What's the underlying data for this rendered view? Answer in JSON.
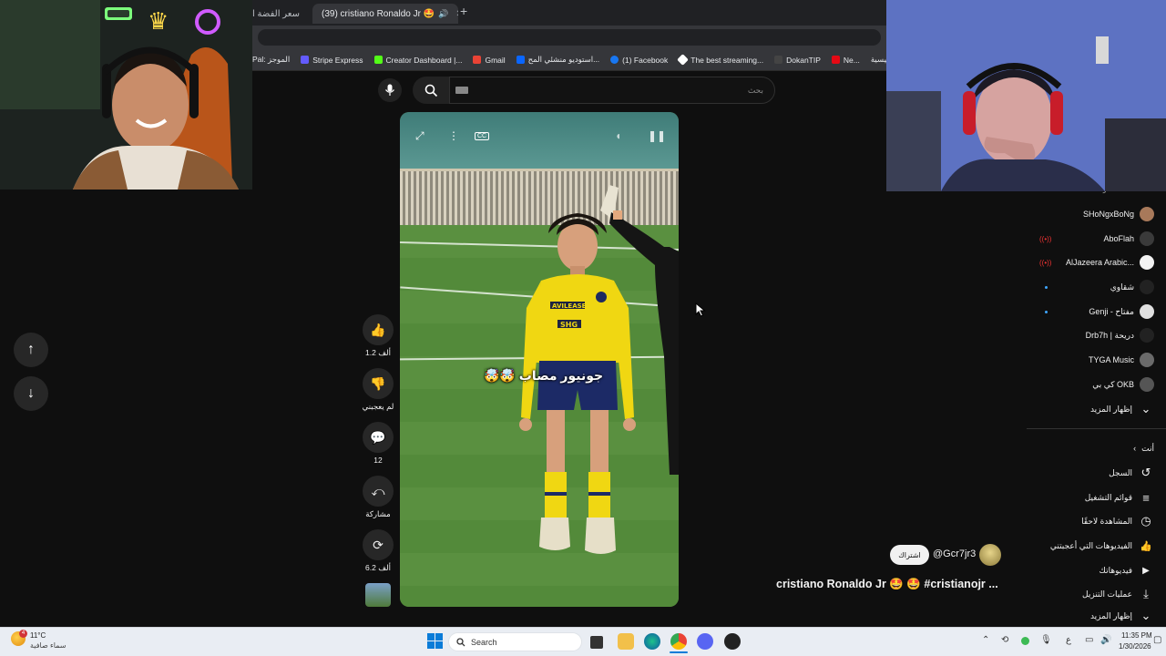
{
  "browser": {
    "tabs": [
      {
        "label": "سعر الفضة ا"
      },
      {
        "label": "(39) cristiano Ronaldo Jr 🤩",
        "active": true
      }
    ],
    "tab_close": "✕",
    "new_tab": "+",
    "bookmarks": [
      {
        "label": "Pal: الموجز",
        "color": "#555"
      },
      {
        "label": "Stripe Express",
        "color": "#635bff"
      },
      {
        "label": "Creator Dashboard |...",
        "color": "#53fc18"
      },
      {
        "label": "Gmail",
        "color": "#ea4335"
      },
      {
        "label": "استوديو منشئي المح...",
        "color": "#0a66ff"
      },
      {
        "label": "(1) Facebook",
        "color": "#1877f2"
      },
      {
        "label": "The best streaming...",
        "color": "#ffffff"
      },
      {
        "label": "DokanTIP",
        "color": "#444"
      },
      {
        "label": "Ne...",
        "color": "#e50914"
      },
      {
        "label": "الصفحة الرئيسية -",
        "color": "#555"
      }
    ]
  },
  "search": {
    "placeholder": "بحث"
  },
  "video": {
    "caption": "جونيور مصاب 🤯🤯",
    "title": "cristiano Ronaldo Jr 🤩 🤩 #cristianojr ...",
    "channel": "@Gcr7jr3",
    "subscribe": "اشتراك",
    "player": {
      "shirt_sponsor": "AVILEASE",
      "shirt_sponsor_2": "SHG"
    }
  },
  "actions": {
    "like_count": "1.2 ألف",
    "dislike_label": "لم يعجبني",
    "comments_count": "12",
    "share_label": "مشاركة",
    "remix_count": "6.2 ألف"
  },
  "sidebar": {
    "section_header": "الاشتراكات",
    "subscriptions": [
      {
        "name": "SHoNgxBoNg",
        "color": "#a8795a",
        "live": false,
        "dot": false
      },
      {
        "name": "AboFlah",
        "color": "#3a3a3a",
        "live": true,
        "dot": false
      },
      {
        "name": "AlJazeera Arabic...",
        "color": "#f2f2f2",
        "live": true,
        "dot": false
      },
      {
        "name": "شقاوي",
        "color": "#222",
        "live": false,
        "dot": true
      },
      {
        "name": "Genji - مفتاح",
        "color": "#e0e0e0",
        "live": false,
        "dot": true
      },
      {
        "name": "Drb7h | دريحة",
        "color": "#222",
        "live": false,
        "dot": false
      },
      {
        "name": "TYGA Music",
        "color": "#6a6a6a",
        "live": false,
        "dot": false
      },
      {
        "name": "كي بي OKB",
        "color": "#555",
        "live": false,
        "dot": false
      }
    ],
    "show_more": "إظهار المزيد",
    "you_header": "أنت",
    "you_items": [
      {
        "label": "السجل",
        "icon": "history-icon",
        "glyph": "↺"
      },
      {
        "label": "قوائم التشغيل",
        "icon": "playlist-icon",
        "glyph": "≡"
      },
      {
        "label": "المشاهدة لاحقًا",
        "icon": "clock-icon",
        "glyph": "◷"
      },
      {
        "label": "الفيديوهات التي أعجبتني",
        "icon": "thumb-up-icon",
        "glyph": "👍"
      },
      {
        "label": "فيديوهاتك",
        "icon": "video-icon",
        "glyph": "▶"
      },
      {
        "label": "عمليات التنزيل",
        "icon": "download-icon",
        "glyph": "⤓"
      }
    ],
    "show_more_2": "إظهار المزيد"
  },
  "taskbar": {
    "weather_temp": "11°C",
    "weather_desc": "سماء صافية",
    "weather_badge": "4",
    "search_label": "Search",
    "lang": "ع",
    "time": "11:35 PM",
    "date": "1/30/2026"
  }
}
